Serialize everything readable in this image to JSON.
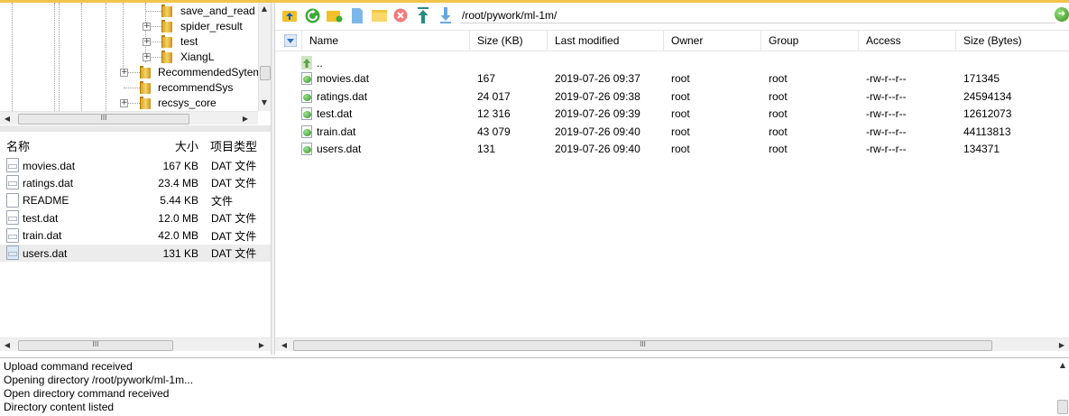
{
  "left_tree": {
    "nodes": [
      {
        "label": "save_and_read",
        "level": 2,
        "expander": ""
      },
      {
        "label": "spider_result",
        "level": 2,
        "expander": "+"
      },
      {
        "label": "test",
        "level": 2,
        "expander": "+"
      },
      {
        "label": "XiangL",
        "level": 2,
        "expander": "+"
      },
      {
        "label": "RecommendedSytem",
        "level": 1,
        "expander": "+"
      },
      {
        "label": "recommendSys",
        "level": 1,
        "expander": ""
      },
      {
        "label": "recsys_core",
        "level": 1,
        "expander": "+"
      }
    ],
    "hscroll_label": "III"
  },
  "local_list": {
    "headers": {
      "name": "名称",
      "size": "大小",
      "type": "项目类型"
    },
    "rows": [
      {
        "name": "movies.dat",
        "size": "167 KB",
        "type": "DAT 文件",
        "icon": "dat-file-icon",
        "selected": false
      },
      {
        "name": "ratings.dat",
        "size": "23.4 MB",
        "type": "DAT 文件",
        "icon": "dat-file-icon",
        "selected": false
      },
      {
        "name": "README",
        "size": "5.44 KB",
        "type": "文件",
        "icon": "plain-file-icon",
        "selected": false
      },
      {
        "name": "test.dat",
        "size": "12.0 MB",
        "type": "DAT 文件",
        "icon": "dat-file-icon",
        "selected": false
      },
      {
        "name": "train.dat",
        "size": "42.0 MB",
        "type": "DAT 文件",
        "icon": "dat-file-icon",
        "selected": false
      },
      {
        "name": "users.dat",
        "size": "131 KB",
        "type": "DAT 文件",
        "icon": "dat-file-icon",
        "selected": true
      }
    ],
    "hscroll_label": "III"
  },
  "remote": {
    "toolbar": [
      "back-folder-icon",
      "refresh-icon",
      "new-folder-icon",
      "new-file-icon",
      "open-folder-icon",
      "delete-icon",
      "upload-icon",
      "download-icon"
    ],
    "path": "/root/pywork/ml-1m/",
    "headers": {
      "name": "Name",
      "size": "Size (KB)",
      "modified": "Last modified",
      "owner": "Owner",
      "group": "Group",
      "access": "Access",
      "size_bytes": "Size (Bytes)"
    },
    "parent_label": "..",
    "rows": [
      {
        "name": "movies.dat",
        "size": "167",
        "modified": "2019-07-26 09:37",
        "owner": "root",
        "group": "root",
        "access": "-rw-r--r--",
        "size_bytes": "171345"
      },
      {
        "name": "ratings.dat",
        "size": "24 017",
        "modified": "2019-07-26 09:38",
        "owner": "root",
        "group": "root",
        "access": "-rw-r--r--",
        "size_bytes": "24594134"
      },
      {
        "name": "test.dat",
        "size": "12 316",
        "modified": "2019-07-26 09:39",
        "owner": "root",
        "group": "root",
        "access": "-rw-r--r--",
        "size_bytes": "12612073"
      },
      {
        "name": "train.dat",
        "size": "43 079",
        "modified": "2019-07-26 09:40",
        "owner": "root",
        "group": "root",
        "access": "-rw-r--r--",
        "size_bytes": "44113813"
      },
      {
        "name": "users.dat",
        "size": "131",
        "modified": "2019-07-26 09:40",
        "owner": "root",
        "group": "root",
        "access": "-rw-r--r--",
        "size_bytes": "134371"
      }
    ],
    "hscroll_label": "III"
  },
  "log": {
    "lines": [
      "Upload command received",
      "Opening directory /root/pywork/ml-1m...",
      "Open directory command received",
      "Directory content listed"
    ]
  },
  "colors": {
    "accent_top": "#f3c44a",
    "selection": "#ececec"
  }
}
